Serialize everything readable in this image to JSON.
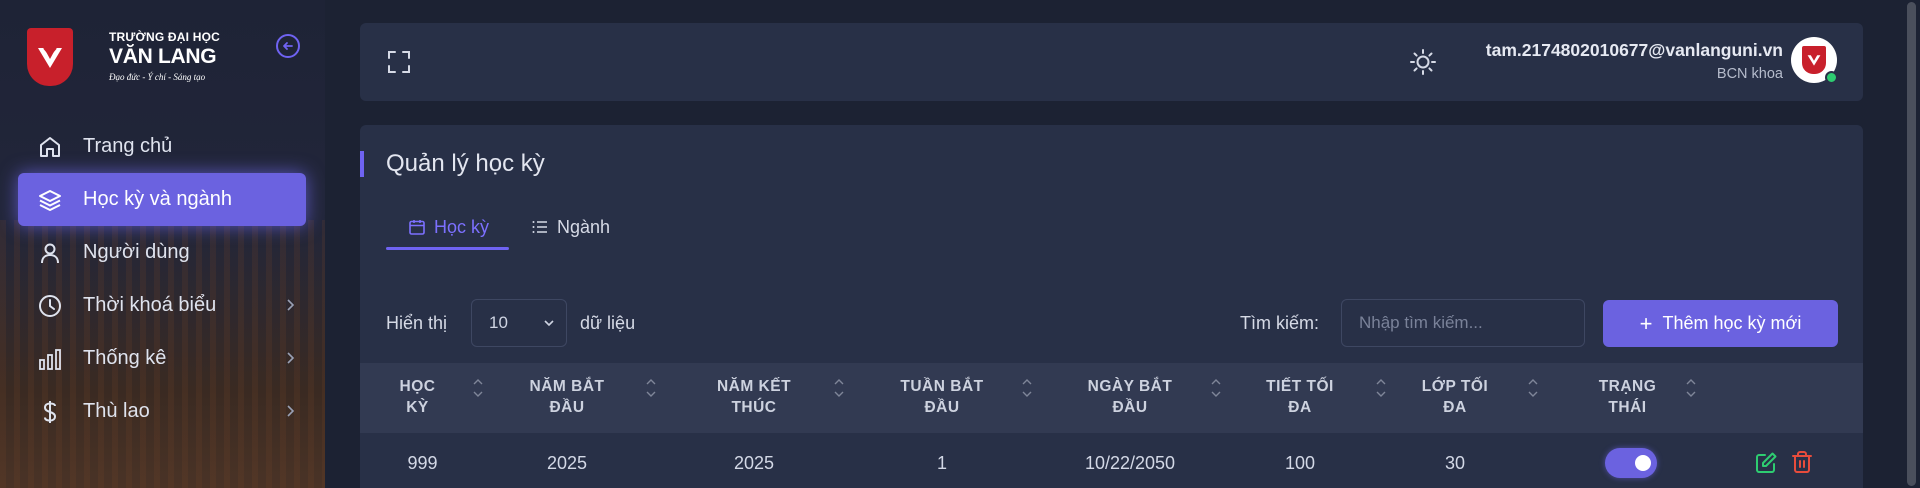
{
  "sidebar": {
    "logo": {
      "line1": "TRƯỜNG ĐẠI HỌC",
      "line2": "VĂN LANG",
      "line3": "Đạo đức - Ý chí - Sáng tạo"
    },
    "items": [
      {
        "label": "Trang chủ",
        "icon": "home-icon"
      },
      {
        "label": "Học kỳ và ngành",
        "icon": "layers-icon",
        "active": true
      },
      {
        "label": "Người dùng",
        "icon": "user-icon"
      },
      {
        "label": "Thời khoá biểu",
        "icon": "clock-icon",
        "has_submenu": true
      },
      {
        "label": "Thống kê",
        "icon": "bar-chart-icon",
        "has_submenu": true
      },
      {
        "label": "Thù lao",
        "icon": "dollar-icon",
        "has_submenu": true
      }
    ]
  },
  "topbar": {
    "user_email": "tam.2174802010677@vanlanguni.vn",
    "user_role": "BCN khoa"
  },
  "main": {
    "title": "Quản lý học kỳ",
    "tabs": [
      {
        "label": "Học kỳ",
        "icon": "calendar-icon",
        "active": true
      },
      {
        "label": "Ngành",
        "icon": "list-icon"
      }
    ],
    "controls": {
      "show_label": "Hiển thị",
      "page_size": "10",
      "data_label": "dữ liệu",
      "search_label": "Tìm kiếm:",
      "search_placeholder": "Nhập tìm kiếm...",
      "add_button": "Thêm học kỳ mới"
    },
    "table": {
      "columns": [
        "HỌC KỲ",
        "NĂM BẮT ĐẦU",
        "NĂM KẾT THÚC",
        "TUẦN BẮT ĐẦU",
        "NGÀY BẮT ĐẦU",
        "TIẾT TỐI ĐA",
        "LỚP TỐI ĐA",
        "TRẠNG THÁI"
      ],
      "columns_display": [
        [
          "HỌC",
          "KỲ"
        ],
        [
          "NĂM BẮT",
          "ĐẦU"
        ],
        [
          "NĂM KẾT",
          "THÚC"
        ],
        [
          "TUẦN BẮT",
          "ĐẦU"
        ],
        [
          "NGÀY BẮT",
          "ĐẦU"
        ],
        [
          "TIẾT TỐI",
          "ĐA"
        ],
        [
          "LỚP TỐI",
          "ĐA"
        ],
        [
          "TRẠNG",
          "THÁI"
        ]
      ],
      "rows": [
        {
          "hoc_ky": "999",
          "nam_bat_dau": "2025",
          "nam_ket_thuc": "2025",
          "tuan_bat_dau": "1",
          "ngay_bat_dau": "10/22/2050",
          "tiet_toi_da": "100",
          "lop_toi_da": "30",
          "trang_thai": true
        }
      ]
    }
  },
  "colors": {
    "accent": "#6b62e0",
    "background": "#1c2233",
    "panel": "#283047",
    "header_row": "#323a52",
    "edit": "#2ecc71",
    "delete": "#e74c3c"
  }
}
